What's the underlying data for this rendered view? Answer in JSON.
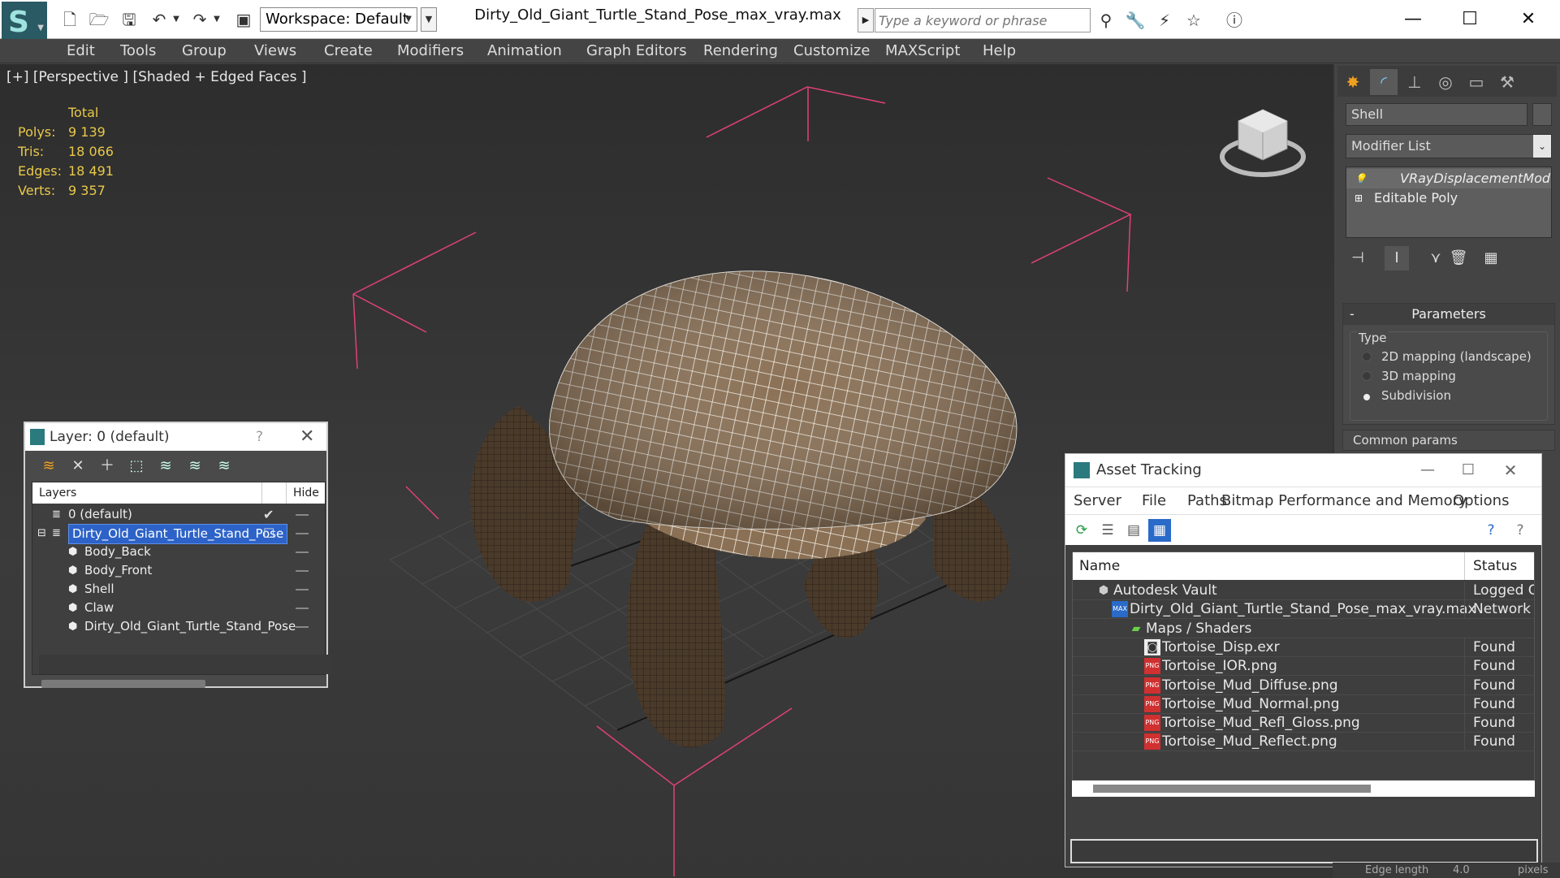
{
  "titlebar": {
    "workspace": "Workspace: Default",
    "doc_title": "Dirty_Old_Giant_Turtle_Stand_Pose_max_vray.max",
    "search_placeholder": "Type a keyword or phrase"
  },
  "menu": [
    "Edit",
    "Tools",
    "Group",
    "Views",
    "Create",
    "Modifiers",
    "Animation",
    "Graph Editors",
    "Rendering",
    "Customize",
    "MAXScript",
    "Help"
  ],
  "viewport": {
    "label": "[+] [Perspective ] [Shaded + Edged Faces ]",
    "stats_header": "Total",
    "stats": [
      {
        "k": "Polys:",
        "v": "9 139"
      },
      {
        "k": "Tris:",
        "v": "18 066"
      },
      {
        "k": "Edges:",
        "v": "18 491"
      },
      {
        "k": "Verts:",
        "v": "9 357"
      }
    ],
    "colors": {
      "stats": "#e8c84a",
      "bbox": "#e0407a",
      "wire": "#ffffff"
    }
  },
  "command_panel": {
    "object_name": "Shell",
    "modifier_list": "Modifier List",
    "stack": [
      "VRayDisplacementMod",
      "Editable Poly"
    ],
    "parameters_title": "Parameters",
    "type_label": "Type",
    "type_options": [
      "2D mapping (landscape)",
      "3D mapping",
      "Subdivision"
    ],
    "type_selected": "Subdivision",
    "common_params": "Common params"
  },
  "layer_dialog": {
    "title": "Layer: 0 (default)",
    "help": "?",
    "col_layers": "Layers",
    "col_hide": "Hide",
    "rows": [
      {
        "name": "0 (default)",
        "indent": 1,
        "kind": "layer"
      },
      {
        "name": "Dirty_Old_Giant_Turtle_Stand_Pose",
        "indent": 1,
        "kind": "layer",
        "selected": true
      },
      {
        "name": "Body_Back",
        "indent": 2,
        "kind": "object"
      },
      {
        "name": "Body_Front",
        "indent": 2,
        "kind": "object"
      },
      {
        "name": "Shell",
        "indent": 2,
        "kind": "object"
      },
      {
        "name": "Claw",
        "indent": 2,
        "kind": "object"
      },
      {
        "name": "Dirty_Old_Giant_Turtle_Stand_Pose",
        "indent": 2,
        "kind": "object"
      }
    ]
  },
  "asset_dialog": {
    "title": "Asset Tracking",
    "menu": [
      "Server",
      "File",
      "Paths",
      "Bitmap Performance and Memory",
      "Options"
    ],
    "col_name": "Name",
    "col_status": "Status",
    "rows": [
      {
        "name": "Autodesk Vault",
        "status": "Logged Out",
        "level": 1,
        "icon": "vault"
      },
      {
        "name": "Dirty_Old_Giant_Turtle_Stand_Pose_max_vray.max",
        "status": "Network Path",
        "level": 2,
        "icon": "max"
      },
      {
        "name": "Maps / Shaders",
        "status": "",
        "level": 3,
        "icon": "maps"
      },
      {
        "name": "Tortoise_Disp.exr",
        "status": "Found",
        "level": 4,
        "icon": "exr"
      },
      {
        "name": "Tortoise_IOR.png",
        "status": "Found",
        "level": 4,
        "icon": "png"
      },
      {
        "name": "Tortoise_Mud_Diffuse.png",
        "status": "Found",
        "level": 4,
        "icon": "png"
      },
      {
        "name": "Tortoise_Mud_Normal.png",
        "status": "Found",
        "level": 4,
        "icon": "png"
      },
      {
        "name": "Tortoise_Mud_Refl_Gloss.png",
        "status": "Found",
        "level": 4,
        "icon": "png"
      },
      {
        "name": "Tortoise_Mud_Reflect.png",
        "status": "Found",
        "level": 4,
        "icon": "png"
      }
    ]
  },
  "statusbar": {
    "edge_length_label": "Edge length",
    "edge_length_value": "4.0",
    "unit": "pixels"
  }
}
